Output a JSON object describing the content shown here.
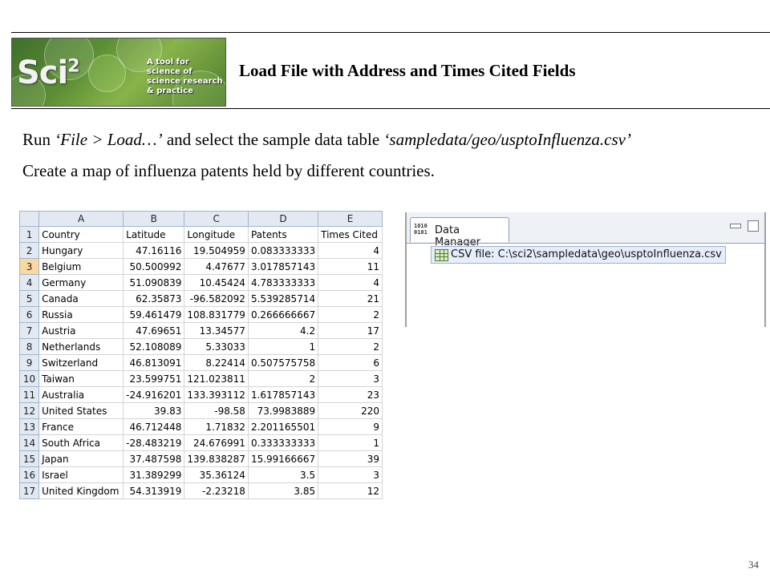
{
  "slide": {
    "title": "Load File with Address and Times Cited Fields",
    "logo_text": "Sci",
    "logo_sup": "2",
    "logo_tagline": "A tool for science of science research & practice",
    "line1_a": "Run ",
    "line1_cmd": "‘File > Load…’",
    "line1_b": " and select the sample data table ",
    "line1_file": "‘sampledata/geo/usptoInfluenza.csv’",
    "line2": "Create a map of influenza patents held by different countries.",
    "page_number": "34"
  },
  "sheet": {
    "columns": [
      "A",
      "B",
      "C",
      "D",
      "E"
    ],
    "header": {
      "row": "1",
      "cells": [
        "Country",
        "Latitude",
        "Longitude",
        "Patents",
        "Times Cited"
      ]
    },
    "rows": [
      {
        "row": "2",
        "cells": [
          "Hungary",
          "47.16116",
          "19.504959",
          "0.083333333",
          "4"
        ]
      },
      {
        "row": "3",
        "cells": [
          "Belgium",
          "50.500992",
          "4.47677",
          "3.017857143",
          "11"
        ]
      },
      {
        "row": "4",
        "cells": [
          "Germany",
          "51.090839",
          "10.45424",
          "4.783333333",
          "4"
        ]
      },
      {
        "row": "5",
        "cells": [
          "Canada",
          "62.35873",
          "-96.582092",
          "5.539285714",
          "21"
        ]
      },
      {
        "row": "6",
        "cells": [
          "Russia",
          "59.461479",
          "108.831779",
          "0.266666667",
          "2"
        ]
      },
      {
        "row": "7",
        "cells": [
          "Austria",
          "47.69651",
          "13.34577",
          "4.2",
          "17"
        ]
      },
      {
        "row": "8",
        "cells": [
          "Netherlands",
          "52.108089",
          "5.33033",
          "1",
          "2"
        ]
      },
      {
        "row": "9",
        "cells": [
          "Switzerland",
          "46.813091",
          "8.22414",
          "0.507575758",
          "6"
        ]
      },
      {
        "row": "10",
        "cells": [
          "Taiwan",
          "23.599751",
          "121.023811",
          "2",
          "3"
        ]
      },
      {
        "row": "11",
        "cells": [
          "Australia",
          "-24.916201",
          "133.393112",
          "1.617857143",
          "23"
        ]
      },
      {
        "row": "12",
        "cells": [
          "United States",
          "39.83",
          "-98.58",
          "73.9983889",
          "220"
        ]
      },
      {
        "row": "13",
        "cells": [
          "France",
          "46.712448",
          "1.71832",
          "2.201165501",
          "9"
        ]
      },
      {
        "row": "14",
        "cells": [
          "South Africa",
          "-28.483219",
          "24.676991",
          "0.333333333",
          "1"
        ]
      },
      {
        "row": "15",
        "cells": [
          "Japan",
          "37.487598",
          "139.838287",
          "15.99166667",
          "39"
        ]
      },
      {
        "row": "16",
        "cells": [
          "Israel",
          "31.389299",
          "35.36124",
          "3.5",
          "3"
        ]
      },
      {
        "row": "17",
        "cells": [
          "United Kingdom",
          "54.313919",
          "-2.23218",
          "3.85",
          "12"
        ]
      }
    ],
    "selected_row": "3"
  },
  "data_manager": {
    "title": "Data Manager",
    "icon_text": "1010 0101",
    "item_label": "CSV file: C:\\sci2\\sampledata\\geo\\usptoInfluenza.csv"
  }
}
